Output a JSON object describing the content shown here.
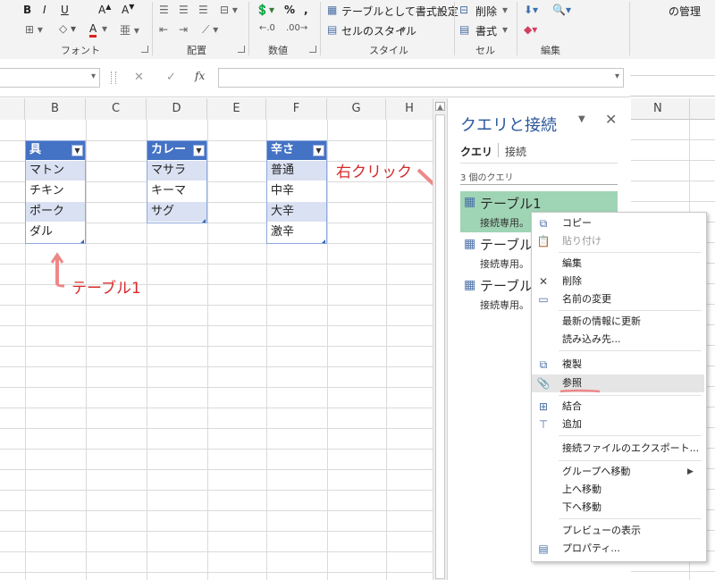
{
  "ribbon": {
    "groups": {
      "font": "フォント",
      "alignment": "配置",
      "number": "数値",
      "style": "スタイル",
      "cells": "セル",
      "editing": "編集"
    },
    "bold": "B",
    "italic": "I",
    "underline": "U",
    "percent": "%",
    "format_as_table": "テーブルとして書式設定",
    "cell_styles": "セルのスタイル",
    "delete": "削除",
    "format": "書式",
    "top_right_text": "の管理"
  },
  "formula_bar": {
    "fx": "fx",
    "cancel": "✕",
    "enter": "✓"
  },
  "sheet": {
    "columns": [
      "B",
      "C",
      "D",
      "E",
      "F",
      "G",
      "H"
    ],
    "right_column": "N",
    "table1": {
      "header": "具",
      "rows": [
        "マトン",
        "チキン",
        "ポーク",
        "ダル"
      ]
    },
    "table2": {
      "header": "カレー",
      "rows": [
        "マサラ",
        "キーマ",
        "サグ"
      ]
    },
    "table3": {
      "header": "辛さ",
      "rows": [
        "普通",
        "中辛",
        "大辛",
        "激辛"
      ]
    }
  },
  "annotations": {
    "right_click": "右クリック",
    "table1": "テーブル1"
  },
  "pane": {
    "title": "クエリと接続",
    "tab_queries": "クエリ",
    "tab_connections": "接続",
    "count": "3 個のクエリ",
    "queries": [
      {
        "name": "テーブル1",
        "sub": "接続専用。"
      },
      {
        "name": "テーブル",
        "sub": "接続専用。"
      },
      {
        "name": "テーブル",
        "sub": "接続専用。"
      }
    ]
  },
  "context_menu": {
    "items": [
      {
        "label": "コピー",
        "icon": "copy-icon"
      },
      {
        "label": "貼り付け",
        "icon": "paste-icon"
      },
      {
        "label": "編集",
        "icon": ""
      },
      {
        "label": "削除",
        "icon": "delete-icon"
      },
      {
        "label": "名前の変更",
        "icon": "rename-icon"
      },
      {
        "label": "最新の情報に更新",
        "icon": ""
      },
      {
        "label": "読み込み先...",
        "icon": ""
      },
      {
        "label": "複製",
        "icon": "duplicate-icon"
      },
      {
        "label": "参照",
        "icon": "reference-icon"
      },
      {
        "label": "結合",
        "icon": "merge-icon"
      },
      {
        "label": "追加",
        "icon": "append-icon"
      },
      {
        "label": "接続ファイルのエクスポート...",
        "icon": ""
      },
      {
        "label": "グループへ移動",
        "icon": ""
      },
      {
        "label": "上へ移動",
        "icon": ""
      },
      {
        "label": "下へ移動",
        "icon": ""
      },
      {
        "label": "プレビューの表示",
        "icon": ""
      },
      {
        "label": "プロパティ...",
        "icon": "properties-icon"
      }
    ]
  },
  "colors": {
    "table_header": "#4472c4",
    "table_band": "#d9e1f2",
    "selected_query": "#9fd5b4",
    "annotation": "#d62a2a"
  }
}
